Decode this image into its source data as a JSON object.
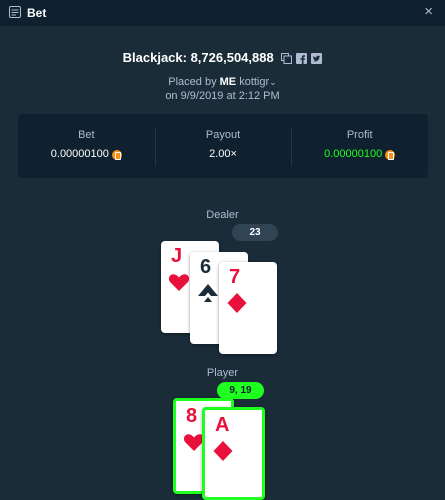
{
  "header": {
    "title": "Bet",
    "close_glyph": "×"
  },
  "game": {
    "title": "Blackjack: 8,726,504,888",
    "icons": [
      "copy-icon",
      "facebook-icon",
      "twitter-icon"
    ],
    "placed_prefix": "Placed by",
    "placed_user_hidden": "ME",
    "placed_user": "kottigr",
    "date_line": "on 9/9/2019 at 2:12 PM"
  },
  "stats": {
    "bet_label": "Bet",
    "bet_value": "0.00000100",
    "payout_label": "Payout",
    "payout_value": "2.00×",
    "profit_label": "Profit",
    "profit_value": "0.00000100",
    "currency_icon": "bitcoin-icon"
  },
  "dealer": {
    "label": "Dealer",
    "score": "23",
    "cards": [
      {
        "rank": "J",
        "suit": "heart",
        "color": "red"
      },
      {
        "rank": "6",
        "suit": "spade",
        "color": "black"
      },
      {
        "rank": "7",
        "suit": "diamond",
        "color": "red"
      }
    ]
  },
  "player": {
    "label": "Player",
    "score": "9, 19",
    "cards": [
      {
        "rank": "8",
        "suit": "heart",
        "color": "red"
      },
      {
        "rank": "A",
        "suit": "diamond",
        "color": "red"
      }
    ]
  },
  "colors": {
    "background": "#1a2c38",
    "panel": "#0f212e",
    "win_green": "#1fff20",
    "card_red": "#e9113c"
  }
}
